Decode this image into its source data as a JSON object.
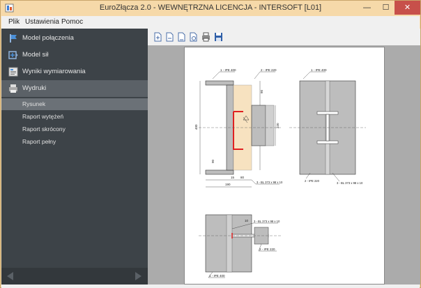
{
  "window": {
    "title": "EuroZłącza 2.0 - WEWNĘTRZNA LICENCJA - INTERSOFT [L01]",
    "min": "—",
    "max": "☐",
    "close": "✕"
  },
  "menu": {
    "items": [
      "Plik",
      "Ustawienia",
      "Pomoc"
    ]
  },
  "sidebar": {
    "items": [
      {
        "label": "Model połączenia",
        "icon": "flag-icon"
      },
      {
        "label": "Model sił",
        "icon": "forces-icon"
      },
      {
        "label": "Wyniki wymiarowania",
        "icon": "results-icon"
      },
      {
        "label": "Wydruki",
        "icon": "printer-icon"
      }
    ],
    "subitems": [
      {
        "label": "Rysunek"
      },
      {
        "label": "Raport wytężeń"
      },
      {
        "label": "Raport skrócony"
      },
      {
        "label": "Raport pełny"
      }
    ]
  },
  "drawing": {
    "label_ipe400_a": "1 - IPE 400",
    "label_ipe220_a": "2 - IPE 220",
    "label_ipe400_b": "1 - IPE 400",
    "label_plate_a": "3 - BL 373 x 98 x 10",
    "label_ipe220_b": "2 - IPE 220",
    "label_plate_b": "3 - BL 373 x 98 x 10",
    "label_plate_c": "3 - BL 373 x 98 x 10",
    "label_ipe220_c": "2 - IPE 220",
    "label_ipe400_c": "1 - IPE 400",
    "dim_400": "400",
    "dim_190": "190",
    "dim_80": "80",
    "dim_15": "15",
    "dim_220": "220",
    "dim_90a": "90",
    "dim_90b": "90",
    "dim_10": "10"
  },
  "colors": {
    "sidebar_bg": "#3d4348",
    "active_item": "#5b6167",
    "close_button": "#c7504a",
    "weld": "#e02020",
    "plate_fill": "#f7e2c0"
  }
}
